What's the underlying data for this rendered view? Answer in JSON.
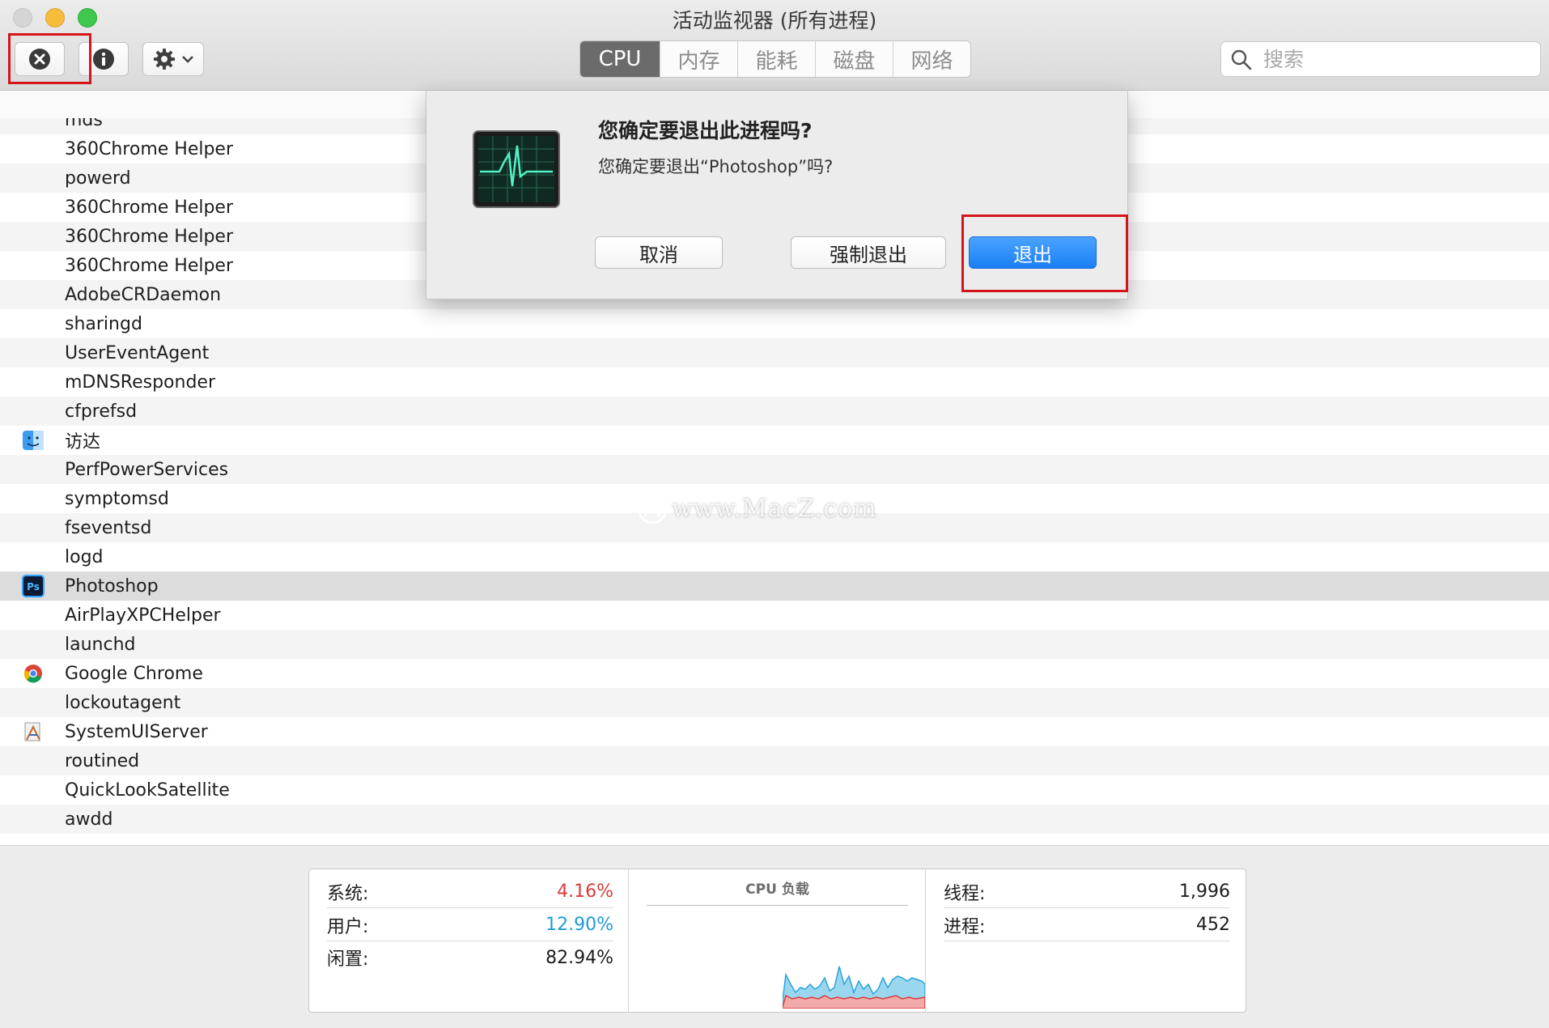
{
  "window": {
    "title": "活动监视器 (所有进程)"
  },
  "toolbar": {
    "tabs": [
      {
        "label": "CPU",
        "active": true
      },
      {
        "label": "内存",
        "active": false
      },
      {
        "label": "能耗",
        "active": false
      },
      {
        "label": "磁盘",
        "active": false
      },
      {
        "label": "网络",
        "active": false
      }
    ],
    "search_placeholder": "搜索"
  },
  "processes": [
    {
      "name": "mds",
      "icon": ""
    },
    {
      "name": "360Chrome Helper",
      "icon": ""
    },
    {
      "name": "powerd",
      "icon": ""
    },
    {
      "name": "360Chrome Helper",
      "icon": ""
    },
    {
      "name": "360Chrome Helper",
      "icon": ""
    },
    {
      "name": "360Chrome Helper",
      "icon": ""
    },
    {
      "name": "AdobeCRDaemon",
      "icon": ""
    },
    {
      "name": "sharingd",
      "icon": ""
    },
    {
      "name": "UserEventAgent",
      "icon": ""
    },
    {
      "name": "mDNSResponder",
      "icon": ""
    },
    {
      "name": "cfprefsd",
      "icon": ""
    },
    {
      "name": "访达",
      "icon": "finder-icon"
    },
    {
      "name": "PerfPowerServices",
      "icon": ""
    },
    {
      "name": "symptomsd",
      "icon": ""
    },
    {
      "name": "fseventsd",
      "icon": ""
    },
    {
      "name": "logd",
      "icon": ""
    },
    {
      "name": "Photoshop",
      "icon": "photoshop-icon",
      "selected": true
    },
    {
      "name": "AirPlayXPCHelper",
      "icon": ""
    },
    {
      "name": "launchd",
      "icon": ""
    },
    {
      "name": "Google Chrome",
      "icon": "chrome-icon"
    },
    {
      "name": "lockoutagent",
      "icon": ""
    },
    {
      "name": "SystemUIServer",
      "icon": "systemuiserver-icon"
    },
    {
      "name": "routined",
      "icon": ""
    },
    {
      "name": "QuickLookSatellite",
      "icon": ""
    },
    {
      "name": "awdd",
      "icon": ""
    }
  ],
  "dialog": {
    "title": "您确定要退出此进程吗?",
    "message": "您确定要退出“Photoshop”吗?",
    "cancel_label": "取消",
    "force_quit_label": "强制退出",
    "quit_label": "退出"
  },
  "stats": {
    "system_label": "系统:",
    "system_value": "4.16%",
    "user_label": "用户:",
    "user_value": "12.90%",
    "idle_label": "闲置:",
    "idle_value": "82.94%",
    "chart_title": "CPU 负载",
    "threads_label": "线程:",
    "threads_value": "1,996",
    "processes_label": "进程:",
    "processes_value": "452"
  },
  "watermark": "www.MacZ.com",
  "colors": {
    "system": "#d63c3c",
    "user": "#1e9bd8",
    "accent": "#1a7ff5",
    "highlight": "#d4151c"
  }
}
